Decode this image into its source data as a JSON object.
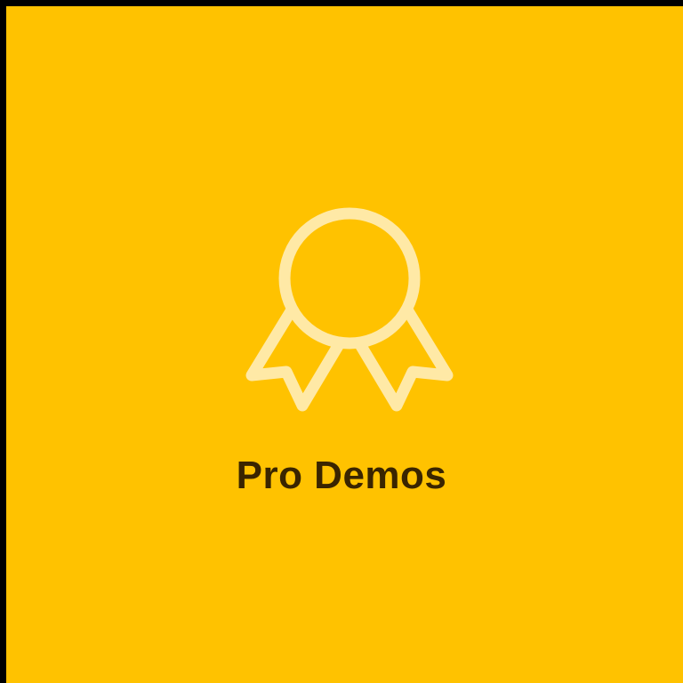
{
  "tile": {
    "label": "Pro Demos",
    "icon": "award-ribbon-icon",
    "background_color": "#FFC200",
    "icon_color": "#FFE9A6",
    "label_color": "#3A2500"
  }
}
